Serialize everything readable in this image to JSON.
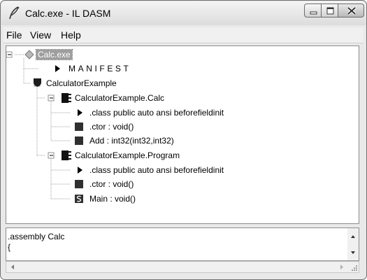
{
  "window": {
    "title": "Calc.exe - IL DASM"
  },
  "menu": {
    "items": [
      "File",
      "View",
      "Help"
    ]
  },
  "tree": {
    "root": "Calc.exe",
    "manifest": "MANIFEST",
    "namespace": "CalculatorExample",
    "classes": [
      {
        "name": "CalculatorExample.Calc",
        "members": [
          ".class public auto ansi beforefieldinit",
          ".ctor : void()",
          "Add : int32(int32,int32)"
        ]
      },
      {
        "name": "CalculatorExample.Program",
        "members": [
          ".class public auto ansi beforefieldinit",
          ".ctor : void()",
          "Main : void()"
        ]
      }
    ]
  },
  "text_pane": {
    "lines": [
      ".assembly Calc",
      "{"
    ]
  },
  "colors": {
    "selection": "#9e9e9e",
    "tree_lines": "#a0a0a0",
    "method_icon": "#303030"
  },
  "icons": {
    "app": "quill-icon",
    "assembly": "gray-diamond-icon",
    "manifest": "triangle-right-icon",
    "namespace": "shield-icon",
    "class": "class-icon",
    "class_info": "triangle-right-icon",
    "method": "method-square-icon",
    "static_method": "static-method-icon",
    "expand": "minus-box-icon"
  }
}
